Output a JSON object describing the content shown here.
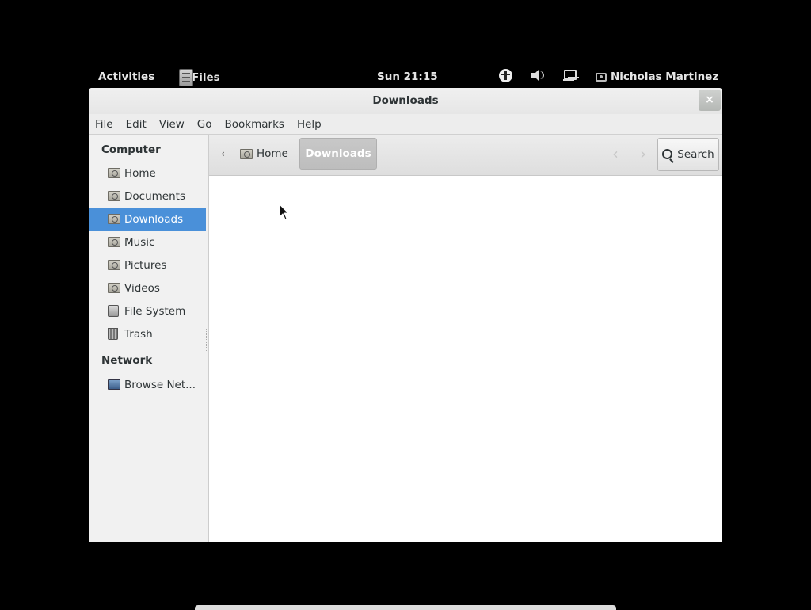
{
  "topbar": {
    "activities": "Activities",
    "app_name": "Files",
    "clock": "Sun 21:15",
    "user": "Nicholas Martinez",
    "icons": [
      "accessibility-icon",
      "volume-icon",
      "network-icon"
    ]
  },
  "window": {
    "title": "Downloads",
    "close": "×"
  },
  "menubar": {
    "items": [
      "File",
      "Edit",
      "View",
      "Go",
      "Bookmarks",
      "Help"
    ]
  },
  "sidebar": {
    "computer_heading": "Computer",
    "items": [
      {
        "label": "Home",
        "icon": "home-folder-icon"
      },
      {
        "label": "Documents",
        "icon": "documents-folder-icon"
      },
      {
        "label": "Downloads",
        "icon": "downloads-folder-icon",
        "selected": true
      },
      {
        "label": "Music",
        "icon": "music-folder-icon"
      },
      {
        "label": "Pictures",
        "icon": "pictures-folder-icon"
      },
      {
        "label": "Videos",
        "icon": "videos-folder-icon"
      },
      {
        "label": "File System",
        "icon": "drive-icon"
      },
      {
        "label": "Trash",
        "icon": "trash-icon"
      }
    ],
    "network_heading": "Network",
    "network_items": [
      {
        "label": "Browse Net...",
        "icon": "browse-network-icon"
      }
    ]
  },
  "toolbar": {
    "path_left": "‹",
    "path_home": "Home",
    "path_current": "Downloads",
    "nav_back": "‹",
    "nav_forward": "›",
    "search_label": "Search"
  },
  "colors": {
    "selection": "#4a90d9",
    "background": "#000000",
    "window_bg": "#ffffff"
  }
}
